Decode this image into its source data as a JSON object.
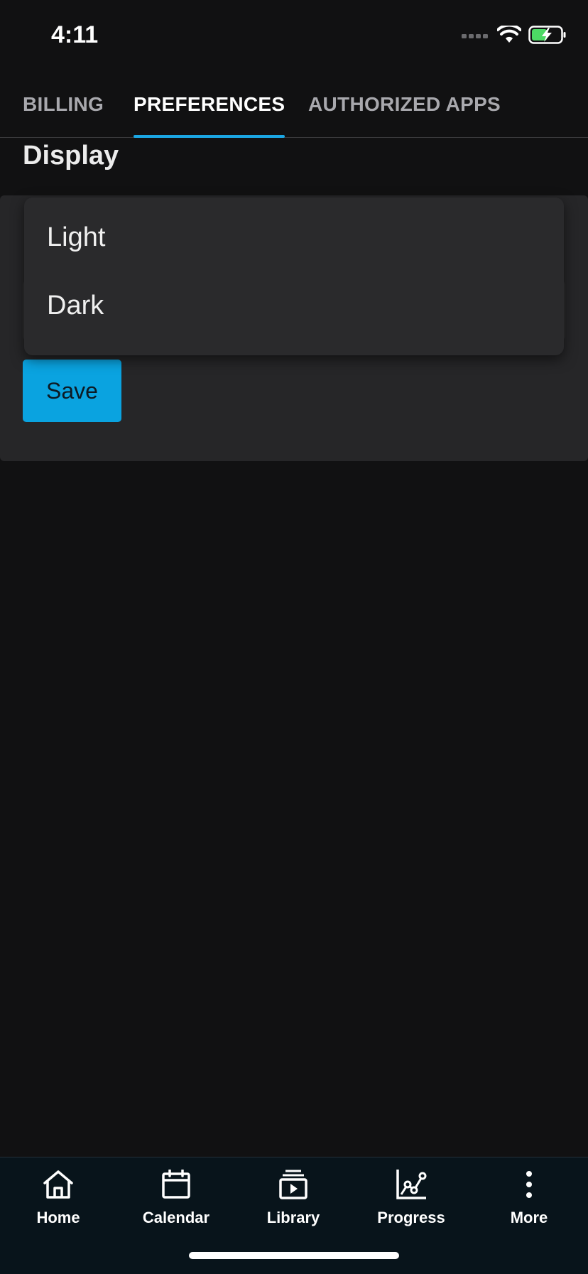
{
  "status_bar": {
    "time": "4:11"
  },
  "tabs": [
    {
      "label": "BILLING",
      "active": false
    },
    {
      "label": "PREFERENCES",
      "active": true
    },
    {
      "label": "AUTHORIZED APPS",
      "active": false
    }
  ],
  "section": {
    "title": "Display"
  },
  "dropdown": {
    "options": [
      "Light",
      "Dark"
    ]
  },
  "form": {
    "save_label": "Save"
  },
  "bottom_nav": [
    {
      "label": "Home",
      "icon": "home-icon"
    },
    {
      "label": "Calendar",
      "icon": "calendar-icon"
    },
    {
      "label": "Library",
      "icon": "library-icon"
    },
    {
      "label": "Progress",
      "icon": "progress-icon"
    },
    {
      "label": "More",
      "icon": "more-icon"
    }
  ],
  "colors": {
    "accent": "#1ba6e3",
    "save_button": "#0aa3e0",
    "background": "#111112",
    "card": "#262628",
    "nav_background": "#08141b",
    "battery_green": "#4cd964"
  }
}
